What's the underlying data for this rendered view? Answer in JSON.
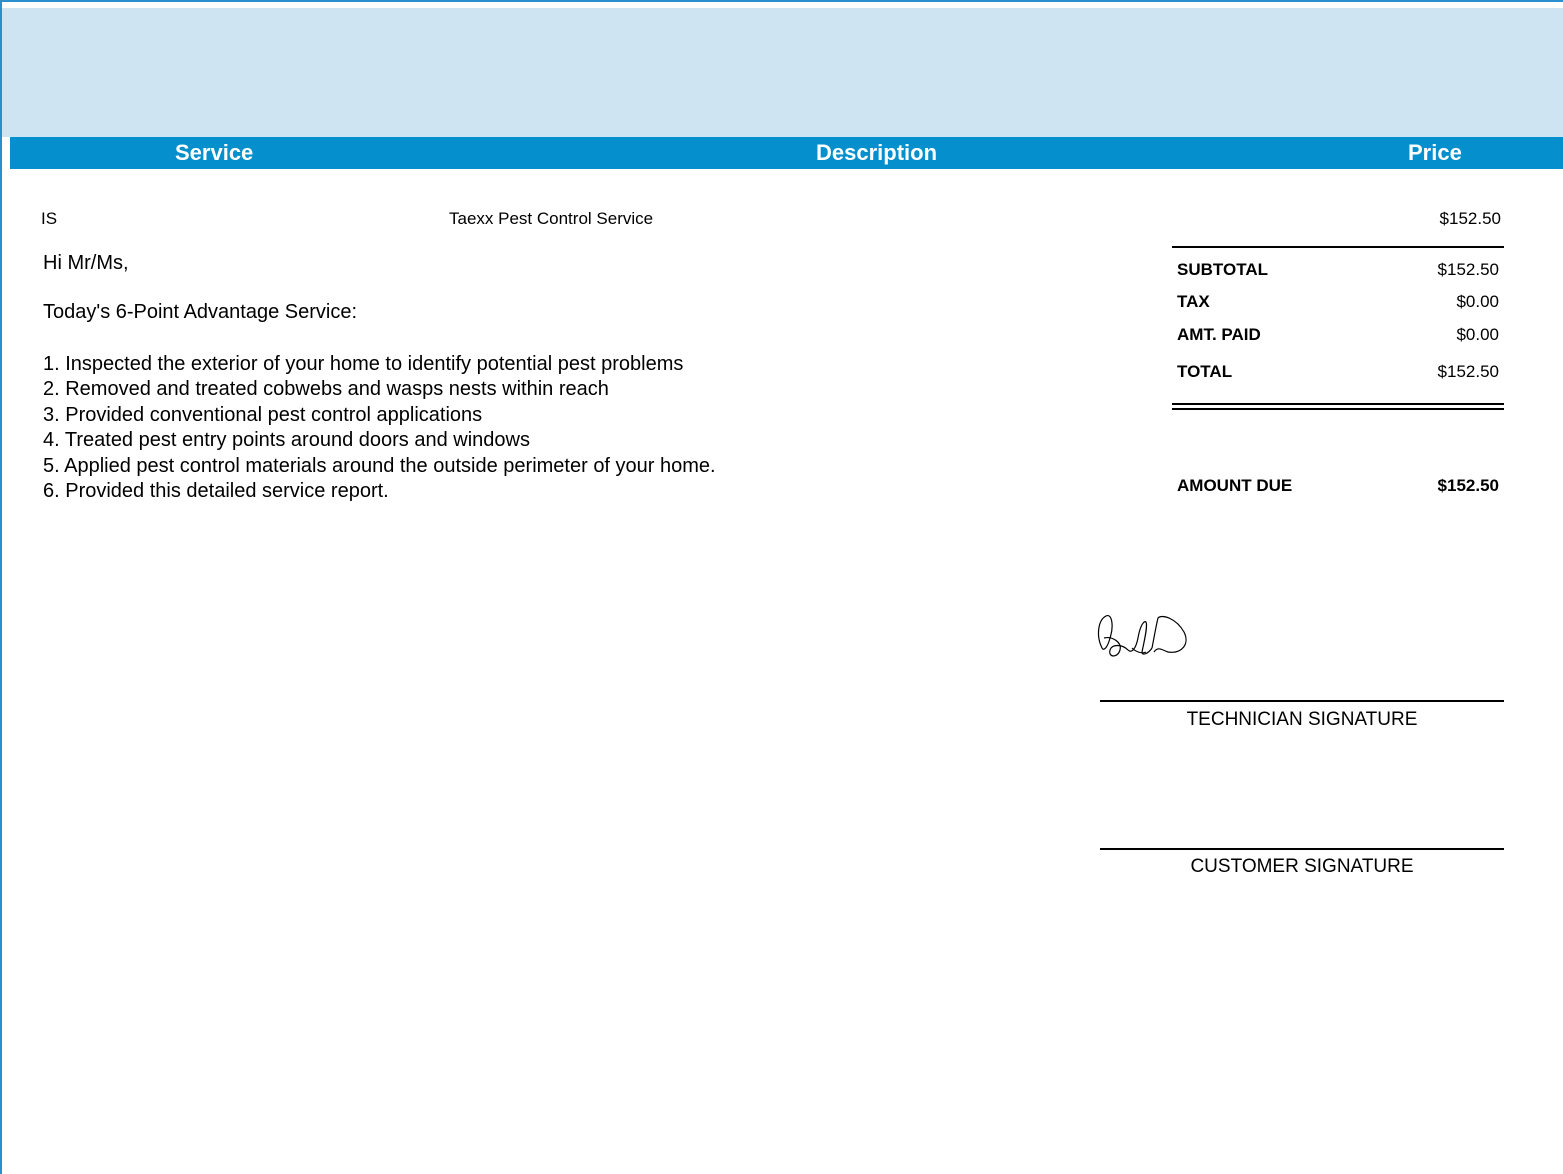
{
  "table_header": {
    "service": "Service",
    "description": "Description",
    "price": "Price"
  },
  "line_item": {
    "service": "IS",
    "description": "Taexx Pest Control Service",
    "price": "$152.50"
  },
  "greeting": "Hi Mr/Ms,",
  "intro": "Today's 6-Point Advantage Service:",
  "points": [
    "1. Inspected the exterior of your home to identify potential pest problems",
    "2. Removed and treated cobwebs and wasps nests within reach",
    "3. Provided conventional pest control applications",
    "4. Treated pest entry points around doors and windows",
    "5. Applied pest control materials around the outside perimeter of your home.",
    "6. Provided this detailed service report."
  ],
  "totals": {
    "subtotal_label": "SUBTOTAL",
    "subtotal_value": "$152.50",
    "tax_label": "TAX",
    "tax_value": "$0.00",
    "amt_paid_label": "AMT. PAID",
    "amt_paid_value": "$0.00",
    "total_label": "TOTAL",
    "total_value": "$152.50",
    "amount_due_label": "AMOUNT DUE",
    "amount_due_value": "$152.50"
  },
  "signatures": {
    "technician_caption": "TECHNICIAN SIGNATURE",
    "customer_caption": "CUSTOMER SIGNATURE"
  },
  "colors": {
    "header_bar": "#0590cd",
    "top_band": "#cfe4f2",
    "page_border": "#2a8fcf"
  }
}
